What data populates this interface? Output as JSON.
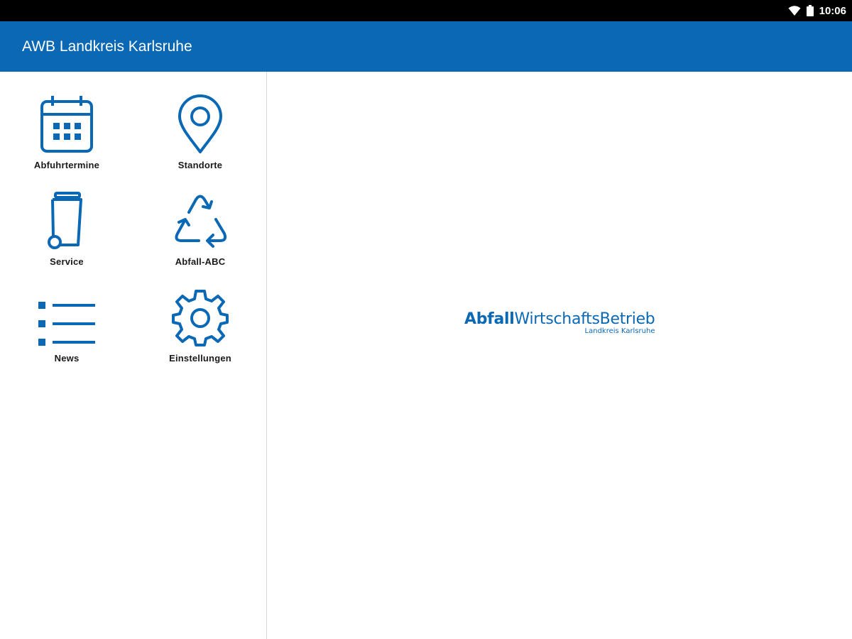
{
  "status_bar": {
    "time": "10:06",
    "icons": [
      "wifi-icon",
      "battery-icon"
    ]
  },
  "app_bar": {
    "title": "AWB Landkreis Karlsruhe"
  },
  "menu": {
    "items": [
      {
        "label": "Abfuhrtermine",
        "icon": "calendar-icon"
      },
      {
        "label": "Standorte",
        "icon": "location-pin-icon"
      },
      {
        "label": "Service",
        "icon": "waste-bin-icon"
      },
      {
        "label": "Abfall-ABC",
        "icon": "recycle-icon"
      },
      {
        "label": "News",
        "icon": "list-icon"
      },
      {
        "label": "Einstellungen",
        "icon": "gear-icon"
      }
    ]
  },
  "logo": {
    "bold_part": "Abfall",
    "regular_part": "WirtschaftsBetrieb",
    "subtitle": "Landkreis Karlsruhe"
  },
  "colors": {
    "brand_blue": "#0a68b5",
    "status_bar": "#000000",
    "label_text": "#1a1a1a",
    "divider": "#d8d8d8"
  }
}
